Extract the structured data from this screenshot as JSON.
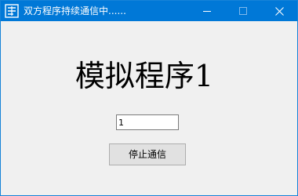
{
  "window": {
    "title": "双方程序持续通信中......",
    "icon": "app-logo-icon",
    "controls": {
      "minimize_icon": "minimize-icon",
      "maximize_icon": "maximize-icon",
      "close_icon": "close-icon"
    },
    "accent_color": "#0078d7"
  },
  "main": {
    "heading": "模拟程序1",
    "input_value": "1",
    "stop_button_label": "停止通信"
  }
}
